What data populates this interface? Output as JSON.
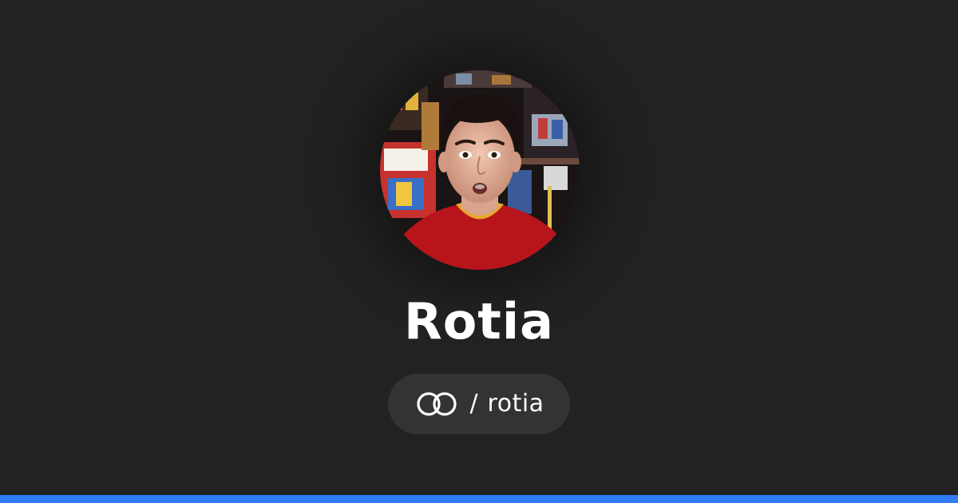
{
  "profile": {
    "display_name": "Rotia",
    "handle": "rotia",
    "separator": "/",
    "avatar_icon": "profile-photo"
  },
  "brand": {
    "logo_icon": "linked-rings-logo-icon",
    "accent_color": "#2f7cf6",
    "background_color": "#222222",
    "pill_color": "#333333"
  }
}
